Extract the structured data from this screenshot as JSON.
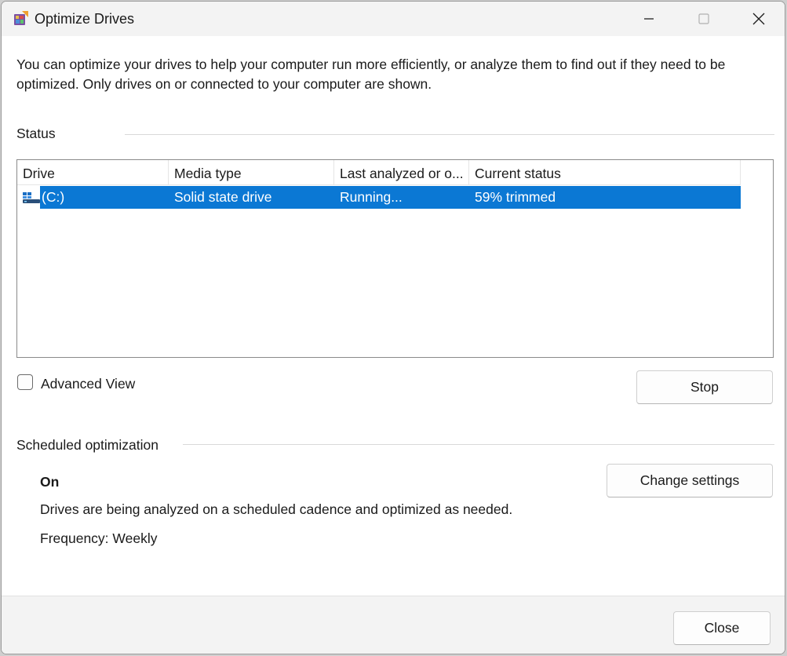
{
  "window": {
    "title": "Optimize Drives",
    "icons": {
      "app": "optimize-drives-icon",
      "minimize": "minimize-icon",
      "maximize": "maximize-icon",
      "close": "close-icon"
    }
  },
  "intro": "You can optimize your drives to help your computer run more efficiently, or analyze them to find out if they need to be optimized. Only drives on or connected to your computer are shown.",
  "status": {
    "label": "Status",
    "columns": [
      "Drive",
      "Media type",
      "Last analyzed or o...",
      "Current status"
    ],
    "drives": [
      {
        "drive": "(C:)",
        "media_type": "Solid state drive",
        "last_analyzed": "Running...",
        "current_status": "59% trimmed",
        "icon": "ssd-drive-icon",
        "selected": true
      }
    ]
  },
  "advanced_view": {
    "label": "Advanced View",
    "checked": false
  },
  "buttons": {
    "stop": "Stop",
    "change_settings": "Change settings",
    "close": "Close"
  },
  "scheduled": {
    "label": "Scheduled optimization",
    "status": "On",
    "description": "Drives are being analyzed on a scheduled cadence and optimized as needed.",
    "frequency": "Frequency: Weekly"
  },
  "colors": {
    "selection": "#0b78d4",
    "titlebar": "#f3f3f3",
    "footer": "#f3f3f3"
  }
}
